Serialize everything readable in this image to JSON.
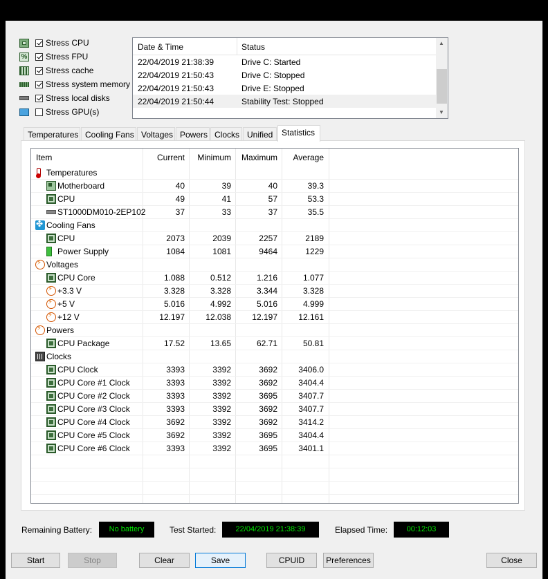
{
  "stress_options": [
    {
      "label": "Stress CPU",
      "checked": true,
      "icon": "cpu-chip-icon"
    },
    {
      "label": "Stress FPU",
      "checked": true,
      "icon": "fpu-percent-icon"
    },
    {
      "label": "Stress cache",
      "checked": true,
      "icon": "cache-chip-icon"
    },
    {
      "label": "Stress system memory",
      "checked": true,
      "icon": "memory-module-icon"
    },
    {
      "label": "Stress local disks",
      "checked": true,
      "icon": "disk-drive-icon"
    },
    {
      "label": "Stress GPU(s)",
      "checked": false,
      "icon": "monitor-gpu-icon"
    }
  ],
  "log": {
    "headers": {
      "datetime": "Date & Time",
      "status": "Status"
    },
    "rows": [
      {
        "datetime": "22/04/2019 21:38:39",
        "status": "Drive C: Started"
      },
      {
        "datetime": "22/04/2019 21:50:43",
        "status": "Drive C: Stopped"
      },
      {
        "datetime": "22/04/2019 21:50:43",
        "status": "Drive E: Stopped"
      },
      {
        "datetime": "22/04/2019 21:50:44",
        "status": "Stability Test: Stopped"
      }
    ]
  },
  "tabs": [
    "Temperatures",
    "Cooling Fans",
    "Voltages",
    "Powers",
    "Clocks",
    "Unified",
    "Statistics"
  ],
  "active_tab": "Statistics",
  "stats": {
    "headers": {
      "item": "Item",
      "current": "Current",
      "minimum": "Minimum",
      "maximum": "Maximum",
      "average": "Average"
    },
    "rows": [
      {
        "group": true,
        "icon": "thermometer-icon",
        "item": "Temperatures"
      },
      {
        "icon": "motherboard-icon",
        "item": "Motherboard",
        "current": "40",
        "minimum": "39",
        "maximum": "40",
        "average": "39.3"
      },
      {
        "icon": "cpu-icon",
        "item": "CPU",
        "current": "49",
        "minimum": "41",
        "maximum": "57",
        "average": "53.3"
      },
      {
        "icon": "hard-disk-icon",
        "item": "ST1000DM010-2EP102",
        "current": "37",
        "minimum": "33",
        "maximum": "37",
        "average": "35.5"
      },
      {
        "group": true,
        "icon": "fan-icon",
        "item": "Cooling Fans"
      },
      {
        "icon": "cpu-icon",
        "item": "CPU",
        "current": "2073",
        "minimum": "2039",
        "maximum": "2257",
        "average": "2189"
      },
      {
        "icon": "battery-icon",
        "item": "Power Supply",
        "current": "1084",
        "minimum": "1081",
        "maximum": "9464",
        "average": "1229"
      },
      {
        "group": true,
        "icon": "voltage-icon",
        "item": "Voltages"
      },
      {
        "icon": "cpu-icon",
        "item": "CPU Core",
        "current": "1.088",
        "minimum": "0.512",
        "maximum": "1.216",
        "average": "1.077"
      },
      {
        "icon": "voltage-icon",
        "item": "+3.3 V",
        "current": "3.328",
        "minimum": "3.328",
        "maximum": "3.344",
        "average": "3.328"
      },
      {
        "icon": "voltage-icon",
        "item": "+5 V",
        "current": "5.016",
        "minimum": "4.992",
        "maximum": "5.016",
        "average": "4.999"
      },
      {
        "icon": "voltage-icon",
        "item": "+12 V",
        "current": "12.197",
        "minimum": "12.038",
        "maximum": "12.197",
        "average": "12.161"
      },
      {
        "group": true,
        "icon": "power-icon",
        "item": "Powers"
      },
      {
        "icon": "cpu-icon",
        "item": "CPU Package",
        "current": "17.52",
        "minimum": "13.65",
        "maximum": "62.71",
        "average": "50.81"
      },
      {
        "group": true,
        "icon": "clock-icon",
        "item": "Clocks"
      },
      {
        "icon": "cpu-icon",
        "item": "CPU Clock",
        "current": "3393",
        "minimum": "3392",
        "maximum": "3692",
        "average": "3406.0"
      },
      {
        "icon": "cpu-icon",
        "item": "CPU Core #1 Clock",
        "current": "3393",
        "minimum": "3392",
        "maximum": "3692",
        "average": "3404.4"
      },
      {
        "icon": "cpu-icon",
        "item": "CPU Core #2 Clock",
        "current": "3393",
        "minimum": "3392",
        "maximum": "3695",
        "average": "3407.7"
      },
      {
        "icon": "cpu-icon",
        "item": "CPU Core #3 Clock",
        "current": "3393",
        "minimum": "3392",
        "maximum": "3692",
        "average": "3407.7"
      },
      {
        "icon": "cpu-icon",
        "item": "CPU Core #4 Clock",
        "current": "3692",
        "minimum": "3392",
        "maximum": "3692",
        "average": "3414.2"
      },
      {
        "icon": "cpu-icon",
        "item": "CPU Core #5 Clock",
        "current": "3692",
        "minimum": "3392",
        "maximum": "3695",
        "average": "3404.4"
      },
      {
        "icon": "cpu-icon",
        "item": "CPU Core #6 Clock",
        "current": "3393",
        "minimum": "3392",
        "maximum": "3695",
        "average": "3401.1"
      }
    ]
  },
  "info": {
    "battery_label": "Remaining Battery:",
    "battery_value": "No battery",
    "test_started_label": "Test Started:",
    "test_started_value": "22/04/2019 21:38:39",
    "elapsed_label": "Elapsed Time:",
    "elapsed_value": "00:12:03"
  },
  "buttons": {
    "start": "Start",
    "stop": "Stop",
    "clear": "Clear",
    "save": "Save",
    "cpuid": "CPUID",
    "preferences": "Preferences",
    "close": "Close"
  },
  "colors": {
    "lcd_background": "#000000",
    "lcd_text": "#00e600",
    "window_background": "#f0f0f0"
  }
}
